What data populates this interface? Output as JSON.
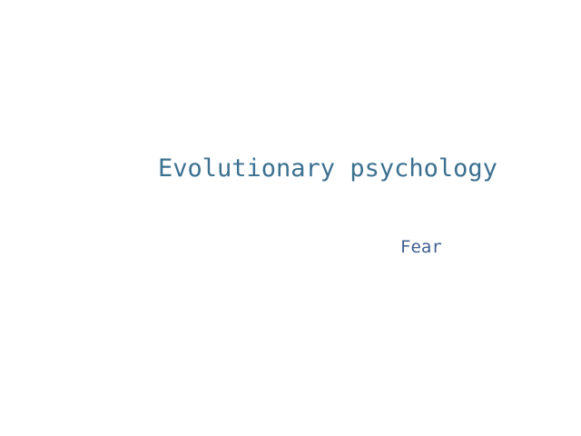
{
  "slide": {
    "title": "Evolutionary psychology",
    "subtitle": "Fear"
  },
  "colors": {
    "background": "#ffffff",
    "title": "#3c7090",
    "subtitle": "#3f5f8f"
  }
}
